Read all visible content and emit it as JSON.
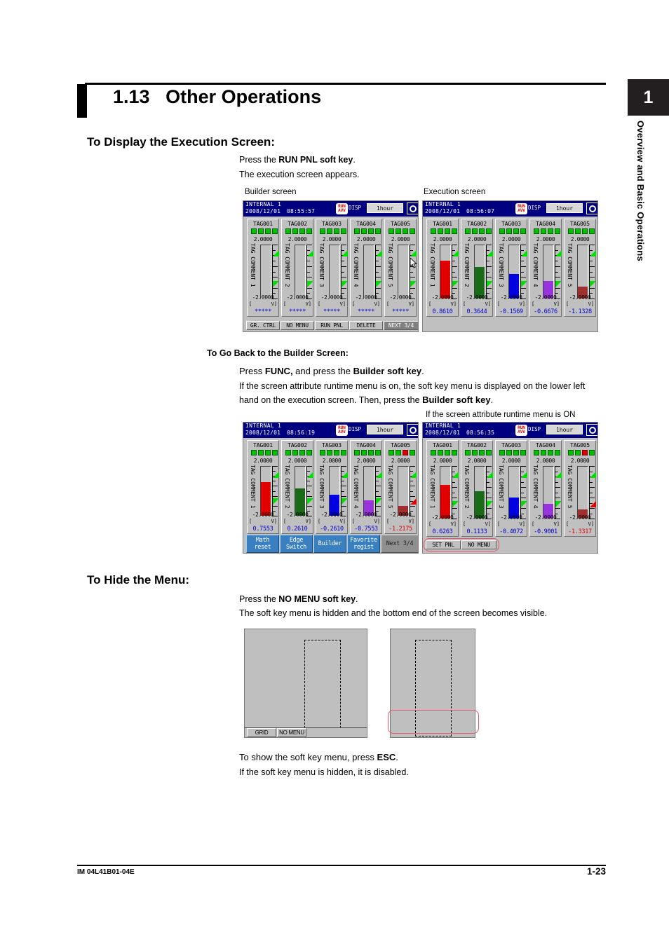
{
  "document": {
    "chapter_number": "1",
    "chapter_title": "Overview and Basic Operations",
    "section_number": "1.13",
    "section_title": "Other Operations",
    "footer_left": "IM 04L41B01-04E",
    "footer_right": "1-23"
  },
  "sections": {
    "display_execution": {
      "heading": "To Display the Execution Screen:",
      "line1_pre": "Press the ",
      "line1_bold": "RUN PNL soft key",
      "line1_post": ".",
      "line2": "The execution screen appears.",
      "caption_left": "Builder screen",
      "caption_right": "Execution screen"
    },
    "go_back_builder": {
      "heading": "To Go Back to the Builder Screen:",
      "line1_a": "Press ",
      "line1_b": "FUNC,",
      "line1_c": " and press the ",
      "line1_d": "Builder soft key",
      "line1_e": ".",
      "para_a": "If the screen attribute runtime menu is on, the soft key menu is displayed on the lower left",
      "para_b": "hand on the execution screen. Then, press the ",
      "para_c": "Builder soft key",
      "para_d": ".",
      "caption_right": "If the screen attribute runtime menu is ON"
    },
    "hide_menu": {
      "heading": "To Hide the Menu:",
      "line1_pre": "Press the ",
      "line1_bold": "NO MENU soft key",
      "line1_post": ".",
      "line2": "The soft key menu is hidden and the bottom end of the screen becomes visible.",
      "line3_pre": "To show the soft key menu, press ",
      "line3_bold": "ESC",
      "line3_post": ".",
      "line4": "If the soft key menu is hidden, it is disabled."
    }
  },
  "colors": {
    "header_blue": "#000080",
    "lcd_gray": "#c0c0c0",
    "digital_blue": "#0000d0",
    "digital_red": "#e00000",
    "alarm_green": "#00c000",
    "alarm_red": "#e00000",
    "menukey_blue": "#3a7fbf",
    "highlight_red": "#e8536b"
  },
  "lcd_common": {
    "group_name": "INTERNAL 1",
    "date": "2008/12/01",
    "disp_label": "DISP",
    "span": "1hour",
    "run_icon_line1": "RUN",
    "run_icon_line2": "AVV",
    "scale_top": "2.0000",
    "scale_bottom": "-2.0000",
    "unit_left": "[",
    "unit_right": "V]",
    "tag_comment_prefix": "TAG COMMENT"
  },
  "screens": {
    "builder": {
      "name": "builder-screen",
      "time": "08:55:57",
      "channels": [
        {
          "tag": "TAG001",
          "comment": "TAG COMMENT 1",
          "value": "*****",
          "value_color": "blue",
          "bar_pct": 0,
          "bar_color": "none",
          "alarms": [
            "green",
            "green",
            "green",
            "green"
          ],
          "lower_tri": "green"
        },
        {
          "tag": "TAG002",
          "comment": "TAG COMMENT 2",
          "value": "*****",
          "value_color": "blue",
          "bar_pct": 0,
          "bar_color": "none",
          "alarms": [
            "green",
            "green",
            "green",
            "green"
          ],
          "lower_tri": "green"
        },
        {
          "tag": "TAG003",
          "comment": "TAG COMMENT 3",
          "value": "*****",
          "value_color": "blue",
          "bar_pct": 0,
          "bar_color": "none",
          "alarms": [
            "green",
            "green",
            "green",
            "green"
          ],
          "lower_tri": "green"
        },
        {
          "tag": "TAG004",
          "comment": "TAG COMMENT 4",
          "value": "*****",
          "value_color": "blue",
          "bar_pct": 0,
          "bar_color": "none",
          "alarms": [
            "green",
            "green",
            "green",
            "green"
          ],
          "lower_tri": "green"
        },
        {
          "tag": "TAG005",
          "comment": "TAG COMMENT 5",
          "value": "*****",
          "value_color": "blue",
          "bar_pct": 0,
          "bar_color": "none",
          "alarms": [
            "green",
            "green",
            "green",
            "green"
          ],
          "lower_tri": "green"
        }
      ],
      "softkeys": [
        {
          "label": "GR. CTRL",
          "selected": false
        },
        {
          "label": "NO MENU",
          "selected": false
        },
        {
          "label": "RUN PNL",
          "selected": false
        },
        {
          "label": "DELETE",
          "selected": false
        },
        {
          "label": "NEXT 3/4",
          "selected": true
        }
      ]
    },
    "execution": {
      "name": "execution-screen",
      "time": "08:56:07",
      "channels": [
        {
          "tag": "TAG001",
          "comment": "TAG COMMENT 1",
          "value": "0.8610",
          "value_color": "blue",
          "bar_pct": 71,
          "bar_color": "#e00000",
          "alarms": [
            "green",
            "green",
            "green",
            "green"
          ],
          "lower_tri": "green"
        },
        {
          "tag": "TAG002",
          "comment": "TAG COMMENT 2",
          "value": "0.3644",
          "value_color": "blue",
          "bar_pct": 59,
          "bar_color": "#1a6b18",
          "alarms": [
            "green",
            "green",
            "green",
            "green"
          ],
          "lower_tri": "green"
        },
        {
          "tag": "TAG003",
          "comment": "TAG COMMENT 3",
          "value": "-0.1569",
          "value_color": "blue",
          "bar_pct": 46,
          "bar_color": "#0000e0",
          "alarms": [
            "green",
            "green",
            "green",
            "green"
          ],
          "lower_tri": "green"
        },
        {
          "tag": "TAG004",
          "comment": "TAG COMMENT 4",
          "value": "-0.6676",
          "value_color": "blue",
          "bar_pct": 33,
          "bar_color": "#9933dd",
          "alarms": [
            "green",
            "green",
            "green",
            "green"
          ],
          "lower_tri": "green"
        },
        {
          "tag": "TAG005",
          "comment": "TAG COMMENT 5",
          "value": "-1.1328",
          "value_color": "blue",
          "bar_pct": 22,
          "bar_color": "#a03030",
          "alarms": [
            "green",
            "green",
            "green",
            "green"
          ],
          "lower_tri": "green"
        }
      ],
      "softkeys": []
    },
    "runtime_menu_on_left": {
      "name": "builder-screen-runtime-menu",
      "time": "08:56:19",
      "channels": [
        {
          "tag": "TAG001",
          "comment": "TAG COMMENT 1",
          "value": "0.7553",
          "value_color": "blue",
          "bar_pct": 68,
          "bar_color": "#e00000",
          "alarms": [
            "green",
            "green",
            "green",
            "green"
          ],
          "lower_tri": "green"
        },
        {
          "tag": "TAG002",
          "comment": "TAG COMMENT 2",
          "value": "0.2610",
          "value_color": "blue",
          "bar_pct": 56,
          "bar_color": "#1a6b18",
          "alarms": [
            "green",
            "green",
            "green",
            "green"
          ],
          "lower_tri": "green"
        },
        {
          "tag": "TAG003",
          "comment": "TAG COMMENT 3",
          "value": "-0.2610",
          "value_color": "blue",
          "bar_pct": 43,
          "bar_color": "#0000e0",
          "alarms": [
            "green",
            "green",
            "green",
            "green"
          ],
          "lower_tri": "green"
        },
        {
          "tag": "TAG004",
          "comment": "TAG COMMENT 4",
          "value": "-0.7553",
          "value_color": "blue",
          "bar_pct": 31,
          "bar_color": "#9933dd",
          "alarms": [
            "green",
            "green",
            "green",
            "green"
          ],
          "lower_tri": "green"
        },
        {
          "tag": "TAG005",
          "comment": "TAG COMMENT 5",
          "value": "-1.2175",
          "value_color": "red",
          "bar_pct": 20,
          "bar_color": "#a03030",
          "alarms": [
            "green",
            "green",
            "red",
            "green"
          ],
          "lower_tri": "red"
        }
      ],
      "menukeys": [
        {
          "line1": "Math",
          "line2": "reset",
          "style": "blue"
        },
        {
          "line1": "Edge",
          "line2": "Switch",
          "style": "blue"
        },
        {
          "line1": "Builder",
          "line2": "",
          "style": "blue"
        },
        {
          "line1": "Favorite",
          "line2": "regist",
          "style": "blue"
        },
        {
          "line1": "Next 3/4",
          "line2": "",
          "style": "gray"
        }
      ]
    },
    "runtime_menu_on_right": {
      "name": "execution-screen-runtime-menu",
      "time": "08:56:35",
      "channels": [
        {
          "tag": "TAG001",
          "comment": "TAG COMMENT 1",
          "value": "0.6263",
          "value_color": "blue",
          "bar_pct": 65,
          "bar_color": "#e00000",
          "alarms": [
            "green",
            "green",
            "green",
            "green"
          ],
          "lower_tri": "green"
        },
        {
          "tag": "TAG002",
          "comment": "TAG COMMENT 2",
          "value": "0.1133",
          "value_color": "blue",
          "bar_pct": 53,
          "bar_color": "#1a6b18",
          "alarms": [
            "green",
            "green",
            "green",
            "green"
          ],
          "lower_tri": "green"
        },
        {
          "tag": "TAG003",
          "comment": "TAG COMMENT 3",
          "value": "-0.4072",
          "value_color": "blue",
          "bar_pct": 40,
          "bar_color": "#0000e0",
          "alarms": [
            "green",
            "green",
            "green",
            "green"
          ],
          "lower_tri": "green"
        },
        {
          "tag": "TAG004",
          "comment": "TAG COMMENT 4",
          "value": "-0.9001",
          "value_color": "blue",
          "bar_pct": 28,
          "bar_color": "#9933dd",
          "alarms": [
            "green",
            "green",
            "green",
            "green"
          ],
          "lower_tri": "green"
        },
        {
          "tag": "TAG005",
          "comment": "TAG COMMENT 5",
          "value": "-1.3317",
          "value_color": "red",
          "bar_pct": 17,
          "bar_color": "#a03030",
          "alarms": [
            "green",
            "green",
            "red",
            "green"
          ],
          "lower_tri": "red"
        }
      ],
      "softkeys": [
        {
          "label": "SET PNL",
          "selected": false
        },
        {
          "label": "NO MENU",
          "selected": false
        }
      ]
    }
  },
  "hide_menu_figures": {
    "left": {
      "name": "screen-with-softkey-menu",
      "softkeys": [
        {
          "label": "GRID",
          "selected": false
        },
        {
          "label": "NO MENU",
          "selected": false
        }
      ]
    },
    "right": {
      "name": "screen-without-softkey-menu",
      "softkeys": []
    }
  }
}
